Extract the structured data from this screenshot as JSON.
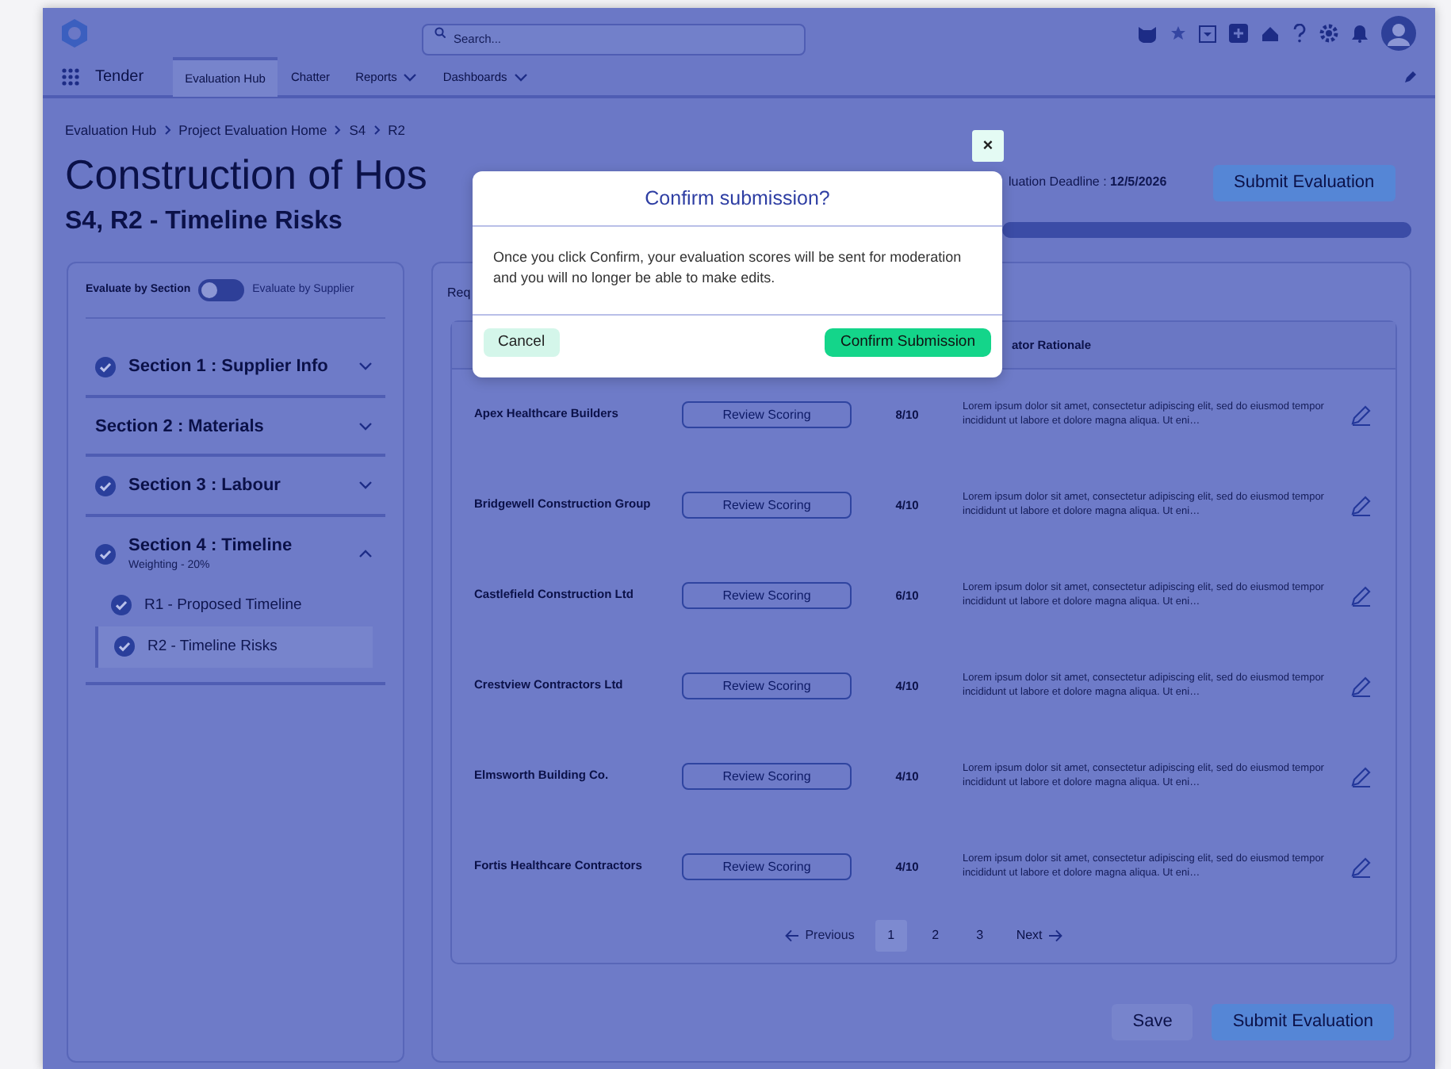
{
  "header": {
    "search": {
      "placeholder": "Search..."
    }
  },
  "nav": {
    "app_name": "Tender",
    "tabs": [
      {
        "label": "Evaluation Hub",
        "selected": true,
        "dropdown": false
      },
      {
        "label": "Chatter",
        "selected": false,
        "dropdown": false
      },
      {
        "label": "Reports",
        "selected": false,
        "dropdown": true
      },
      {
        "label": "Dashboards",
        "selected": false,
        "dropdown": true
      }
    ]
  },
  "breadcrumb": [
    "Evaluation Hub",
    "Project Evaluation Home",
    "S4",
    "R2"
  ],
  "title": "Construction of Hos",
  "subtitle": "S4, R2 - Timeline Risks",
  "deadline": "luation Deadline : **12/5/2026**",
  "submit_top": "Submit Evaluation",
  "progress": {
    "level": 1
  },
  "sidebar": {
    "toggle": {
      "left_label": "Evaluate by Section",
      "right_label": "Evaluate by Supplier",
      "on": false
    },
    "sections": [
      {
        "title": "Section 1 : Supplier Info",
        "complete": true,
        "expanded": false
      },
      {
        "title": "Section 2 : Materials",
        "complete": false,
        "expanded": false
      },
      {
        "title": "Section 3 : Labour",
        "complete": true,
        "expanded": false
      },
      {
        "title": "Section 4 : Timeline",
        "subtitle": "Weighting - 20%",
        "complete": true,
        "expanded": true,
        "children": [
          {
            "title": "R1 - Proposed Timeline",
            "complete": true,
            "selected": false
          },
          {
            "title": "R2 - Timeline Risks",
            "complete": true,
            "selected": true
          }
        ]
      }
    ]
  },
  "main": {
    "heading": "Req",
    "table": {
      "rationale_heading": "ator Rationale",
      "rows": [
        {
          "supplier": "Apex Healthcare Builders",
          "action": "Review Scoring",
          "score": "8/10",
          "rationale": "Lorem ipsum dolor sit amet, consectetur adipiscing elit, sed do eiusmod tempor incididunt ut labore et dolore magna aliqua. Ut eni…"
        },
        {
          "supplier": "Bridgewell Construction Group",
          "action": "Review Scoring",
          "score": "4/10",
          "rationale": "Lorem ipsum dolor sit amet, consectetur adipiscing elit, sed do eiusmod tempor incididunt ut labore et dolore magna aliqua. Ut eni…"
        },
        {
          "supplier": "Castlefield Construction Ltd",
          "action": "Review Scoring",
          "score": "6/10",
          "rationale": "Lorem ipsum dolor sit amet, consectetur adipiscing elit, sed do eiusmod tempor incididunt ut labore et dolore magna aliqua. Ut eni…"
        },
        {
          "supplier": "Crestview Contractors Ltd",
          "action": "Review Scoring",
          "score": "4/10",
          "rationale": "Lorem ipsum dolor sit amet, consectetur adipiscing elit, sed do eiusmod tempor incididunt ut labore et dolore magna aliqua. Ut eni…"
        },
        {
          "supplier": "Elmsworth Building Co.",
          "action": "Review Scoring",
          "score": "4/10",
          "rationale": "Lorem ipsum dolor sit amet, consectetur adipiscing elit, sed do eiusmod tempor incididunt ut labore et dolore magna aliqua. Ut eni…"
        },
        {
          "supplier": "Fortis Healthcare Contractors",
          "action": "Review Scoring",
          "score": "4/10",
          "rationale": "Lorem ipsum dolor sit amet, consectetur adipiscing elit, sed do eiusmod tempor incididunt ut labore et dolore magna aliqua. Ut eni…"
        }
      ]
    },
    "pagination": {
      "previous": "Previous",
      "pages": [
        {
          "label": "1",
          "selected": true
        },
        {
          "label": "2",
          "selected": false
        },
        {
          "label": "3",
          "selected": false
        }
      ],
      "next": "Next"
    },
    "buttons": {
      "save": "Save",
      "submit": "Submit Evaluation"
    }
  },
  "modal": {
    "close": "×",
    "title": "Confirm submission?",
    "body": "Once you click Confirm, your evaluation scores will be sent for moderation and you will no longer be able to make edits.",
    "cancel": "Cancel",
    "confirm": "Confirm Submission"
  }
}
